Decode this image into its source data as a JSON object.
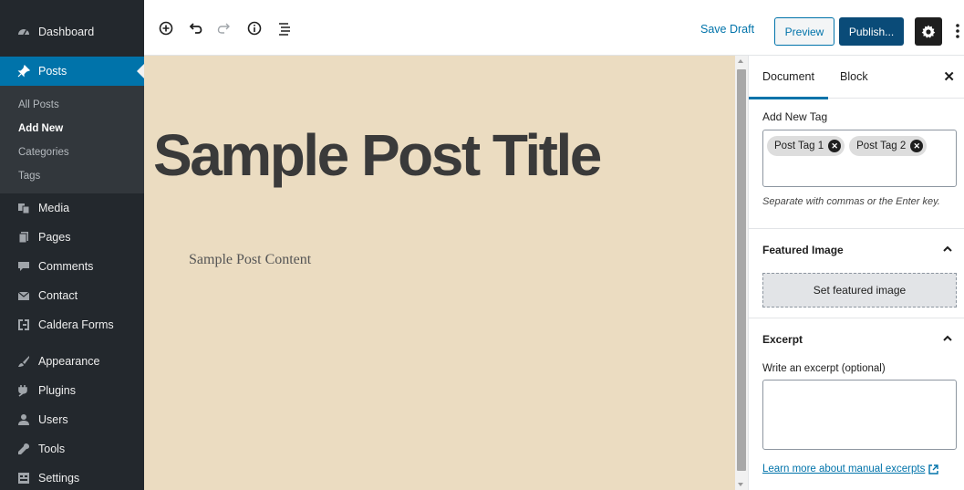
{
  "sidebar": {
    "items_top": [
      {
        "label": "Dashboard",
        "icon": "dashboard-icon"
      },
      {
        "label": "Posts",
        "icon": "pin-icon"
      }
    ],
    "submenu": [
      {
        "label": "All Posts"
      },
      {
        "label": "Add New"
      },
      {
        "label": "Categories"
      },
      {
        "label": "Tags"
      }
    ],
    "items_mid": [
      {
        "label": "Media",
        "icon": "media-icon"
      },
      {
        "label": "Pages",
        "icon": "pages-icon"
      },
      {
        "label": "Comments",
        "icon": "comments-icon"
      },
      {
        "label": "Contact",
        "icon": "mail-icon"
      },
      {
        "label": "Caldera Forms",
        "icon": "caldera-forms-icon"
      }
    ],
    "items_bottom": [
      {
        "label": "Appearance",
        "icon": "brush-icon"
      },
      {
        "label": "Plugins",
        "icon": "plugin-icon"
      },
      {
        "label": "Users",
        "icon": "users-icon"
      },
      {
        "label": "Tools",
        "icon": "wrench-icon"
      },
      {
        "label": "Settings",
        "icon": "settings-icon"
      }
    ]
  },
  "toolbar": {
    "save_draft": "Save Draft",
    "preview": "Preview",
    "publish": "Publish..."
  },
  "editor": {
    "title": "Sample Post Title",
    "content": "Sample Post Content"
  },
  "panel": {
    "tabs": [
      "Document",
      "Block"
    ],
    "tags": {
      "label": "Add New Tag",
      "items": [
        "Post Tag 1",
        "Post Tag 2"
      ],
      "hint": "Separate with commas or the Enter key."
    },
    "featured_image": {
      "heading": "Featured Image",
      "button": "Set featured image"
    },
    "excerpt": {
      "heading": "Excerpt",
      "label": "Write an excerpt (optional)",
      "value": "",
      "link": "Learn more about manual excerpts"
    }
  },
  "colors": {
    "sidebar_bg": "#23282d",
    "active_blue": "#0073aa",
    "publish_bg": "#0a4b78",
    "canvas_bg": "#ebdcc1"
  }
}
